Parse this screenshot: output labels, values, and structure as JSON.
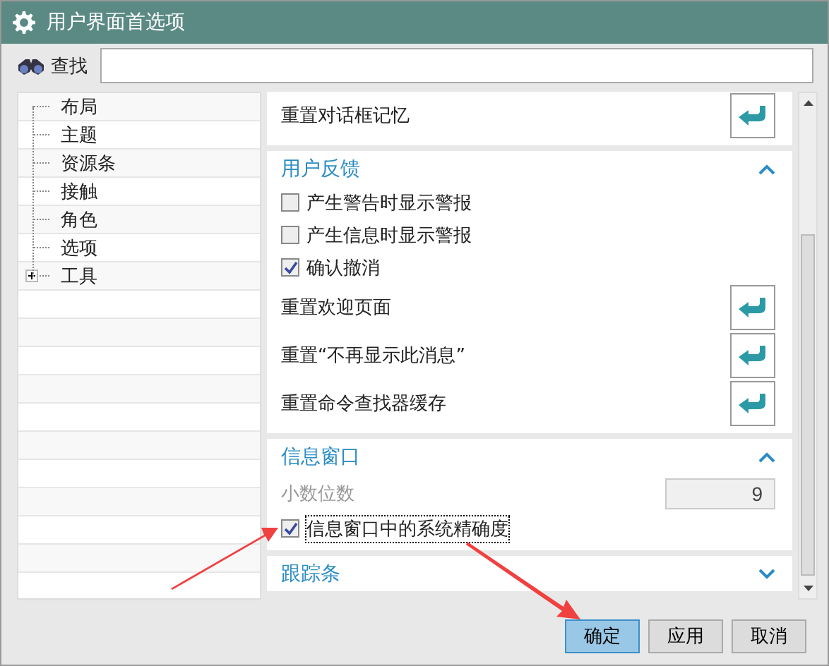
{
  "window": {
    "title": "用户界面首选项"
  },
  "search": {
    "label": "查找"
  },
  "tree": [
    {
      "label": "布局"
    },
    {
      "label": "主题"
    },
    {
      "label": "资源条"
    },
    {
      "label": "接触"
    },
    {
      "label": "角色"
    },
    {
      "label": "选项"
    },
    {
      "label": "工具",
      "expanded": false
    }
  ],
  "sections": [
    {
      "rows": [
        {
          "kind": "reset",
          "label": "重置对话框记忆"
        }
      ]
    },
    {
      "title": "用户反馈",
      "expanded": true,
      "rows": [
        {
          "kind": "checkbox",
          "label": "产生警告时显示警报",
          "checked": false
        },
        {
          "kind": "checkbox",
          "label": "产生信息时显示警报",
          "checked": false
        },
        {
          "kind": "checkbox",
          "label": "确认撤消",
          "checked": true
        },
        {
          "kind": "reset",
          "label": "重置欢迎页面"
        },
        {
          "kind": "reset",
          "label": "重置“不再显示此消息”"
        },
        {
          "kind": "reset",
          "label": "重置命令查找器缓存"
        }
      ]
    },
    {
      "title": "信息窗口",
      "expanded": true,
      "rows": [
        {
          "kind": "number",
          "label": "小数位数",
          "value": "9",
          "disabled": true
        },
        {
          "kind": "checkbox",
          "label": "信息窗口中的系统精确度",
          "checked": true,
          "focused": true
        }
      ]
    },
    {
      "title": "跟踪条",
      "expanded": false
    }
  ],
  "buttons": [
    {
      "label": "确定",
      "selected": true
    },
    {
      "label": "应用",
      "selected": false
    },
    {
      "label": "取消",
      "selected": false
    }
  ]
}
